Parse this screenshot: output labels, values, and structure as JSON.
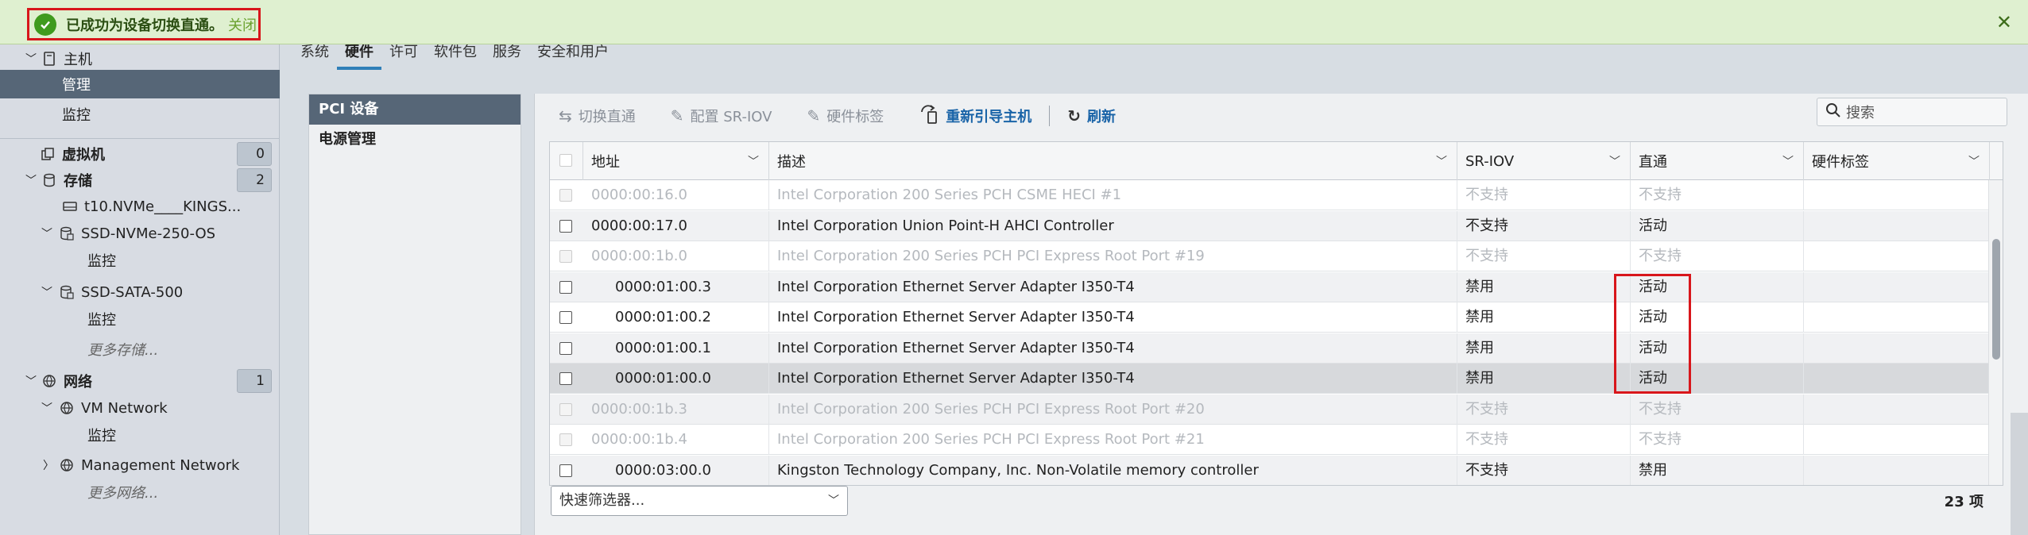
{
  "notification": {
    "message": "已成功为设备切换直通。",
    "close_link": "关闭",
    "close_icon": "close-icon",
    "status_icon": "check-circle-icon",
    "color": "#3f9b1e"
  },
  "sidebar": {
    "host_label": "主机",
    "manage_label": "管理",
    "monitor_label": "监控",
    "vms_label": "虚拟机",
    "vms_count": "0",
    "storage_label": "存储",
    "storage_count": "2",
    "datastore_1": "t10.NVMe____KINGS...",
    "datastore_2": "SSD-NVMe-250-OS",
    "datastore_2_monitor": "监控",
    "datastore_3": "SSD-SATA-500",
    "datastore_3_monitor": "监控",
    "more_storage": "更多存储...",
    "network_label": "网络",
    "network_count": "1",
    "network_1": "VM Network",
    "network_1_monitor": "监控",
    "network_2": "Management Network",
    "more_network": "更多网络..."
  },
  "tabs": [
    {
      "label": "系统",
      "active": false
    },
    {
      "label": "硬件",
      "active": true
    },
    {
      "label": "许可",
      "active": false
    },
    {
      "label": "软件包",
      "active": false
    },
    {
      "label": "服务",
      "active": false
    },
    {
      "label": "安全和用户",
      "active": false
    }
  ],
  "subnav": {
    "pci": "PCI 设备",
    "power": "电源管理"
  },
  "toolbar": {
    "toggle": "切换直通",
    "sriov": "配置 SR-IOV",
    "tags": "硬件标签",
    "reboot": "重新引导主机",
    "refresh": "刷新",
    "search_placeholder": "搜索"
  },
  "grid": {
    "headers": {
      "address": "地址",
      "description": "描述",
      "sriov": "SR-IOV",
      "passthrough": "直通",
      "tag": "硬件标签"
    },
    "rows": [
      {
        "address": "0000:00:16.0",
        "description": "Intel Corporation 200 Series PCH CSME HECI #1",
        "sriov": "不支持",
        "passthrough": "不支持",
        "disabled": true
      },
      {
        "address": "0000:00:17.0",
        "description": "Intel Corporation Union Point-H AHCI Controller",
        "sriov": "不支持",
        "passthrough": "活动",
        "disabled": false
      },
      {
        "address": "0000:00:1b.0",
        "description": "Intel Corporation 200 Series PCH PCI Express Root Port #19",
        "sriov": "不支持",
        "passthrough": "不支持",
        "disabled": true
      },
      {
        "address": "0000:01:00.3",
        "description": "Intel Corporation Ethernet Server Adapter I350-T4",
        "sriov": "禁用",
        "passthrough": "活动",
        "disabled": false
      },
      {
        "address": "0000:01:00.2",
        "description": "Intel Corporation Ethernet Server Adapter I350-T4",
        "sriov": "禁用",
        "passthrough": "活动",
        "disabled": false
      },
      {
        "address": "0000:01:00.1",
        "description": "Intel Corporation Ethernet Server Adapter I350-T4",
        "sriov": "禁用",
        "passthrough": "活动",
        "disabled": false
      },
      {
        "address": "0000:01:00.0",
        "description": "Intel Corporation Ethernet Server Adapter I350-T4",
        "sriov": "禁用",
        "passthrough": "活动",
        "disabled": false
      },
      {
        "address": "0000:00:1b.3",
        "description": "Intel Corporation 200 Series PCH PCI Express Root Port #20",
        "sriov": "不支持",
        "passthrough": "不支持",
        "disabled": true
      },
      {
        "address": "0000:00:1b.4",
        "description": "Intel Corporation 200 Series PCH PCI Express Root Port #21",
        "sriov": "不支持",
        "passthrough": "不支持",
        "disabled": true
      },
      {
        "address": "0000:03:00.0",
        "description": "Kingston Technology Company, Inc. Non-Volatile memory controller",
        "sriov": "不支持",
        "passthrough": "禁用",
        "disabled": false
      }
    ]
  },
  "filter": {
    "placeholder": "快速筛选器..."
  },
  "item_count": "23 项",
  "colors": {
    "selected_bg": "#566677",
    "accent": "#1a64a8",
    "highlight": "#d8161b"
  }
}
